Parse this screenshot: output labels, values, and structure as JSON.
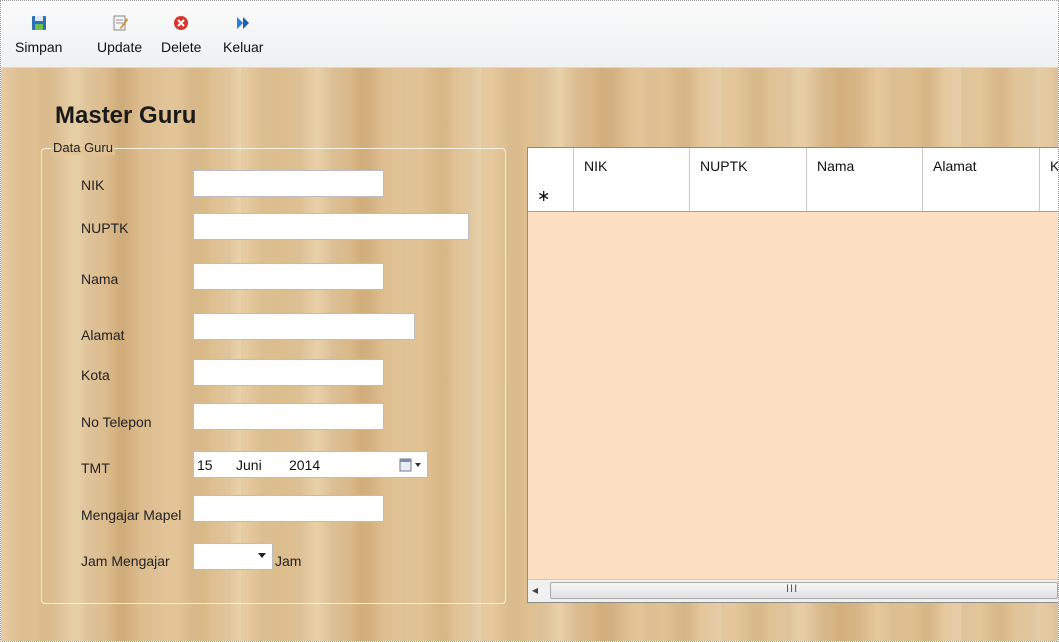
{
  "toolbar": {
    "items": [
      {
        "label": "Simpan",
        "icon": "save-icon"
      },
      {
        "label": "Update",
        "icon": "update-icon"
      },
      {
        "label": "Delete",
        "icon": "delete-icon"
      },
      {
        "label": "Keluar",
        "icon": "exit-icon"
      }
    ]
  },
  "form": {
    "title": "Master Guru",
    "group_label": "Data Guru",
    "fields": {
      "nik": {
        "label": "NIK",
        "value": ""
      },
      "nuptk": {
        "label": "NUPTK",
        "value": ""
      },
      "nama": {
        "label": "Nama",
        "value": ""
      },
      "alamat": {
        "label": "Alamat",
        "value": ""
      },
      "kota": {
        "label": "Kota",
        "value": ""
      },
      "no_telepon": {
        "label": "No Telepon",
        "value": ""
      },
      "tmt": {
        "label": "TMT",
        "day": "15",
        "month": "Juni",
        "year": "2014"
      },
      "mengajar_mapel": {
        "label": "Mengajar Mapel",
        "value": ""
      },
      "jam_mengajar": {
        "label": "Jam Mengajar",
        "value": "",
        "unit": "Jam"
      }
    }
  },
  "grid": {
    "columns": [
      "NIK",
      "NUPTK",
      "Nama",
      "Alamat",
      "Ko"
    ],
    "new_row_marker": "∗",
    "scroll_grip": "III",
    "scroll_left": "◂"
  },
  "colors": {
    "grid_background": "#fddfc2",
    "delete_icon": "#d9352b",
    "save_icon": "#2f6fb8",
    "exit_icon": "#2a7fd6"
  }
}
